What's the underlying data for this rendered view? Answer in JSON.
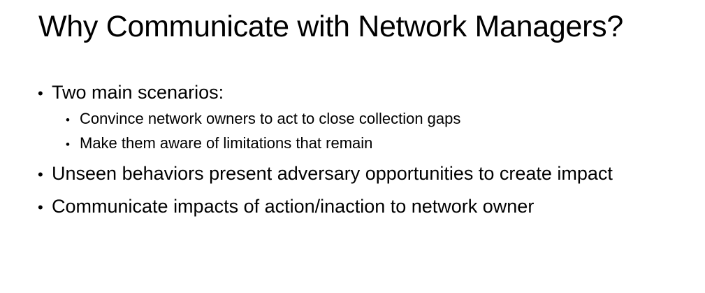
{
  "slide": {
    "title": "Why Communicate with Network Managers?",
    "bullet_glyph": "•",
    "bullets": [
      {
        "text": "Two main scenarios:",
        "children": [
          "Convince network owners to act to close collection gaps",
          "Make them aware of limitations that remain"
        ]
      },
      {
        "text": "Unseen behaviors present adversary opportunities to create impact"
      },
      {
        "text": "Communicate impacts of action/inaction to network owner"
      }
    ]
  }
}
